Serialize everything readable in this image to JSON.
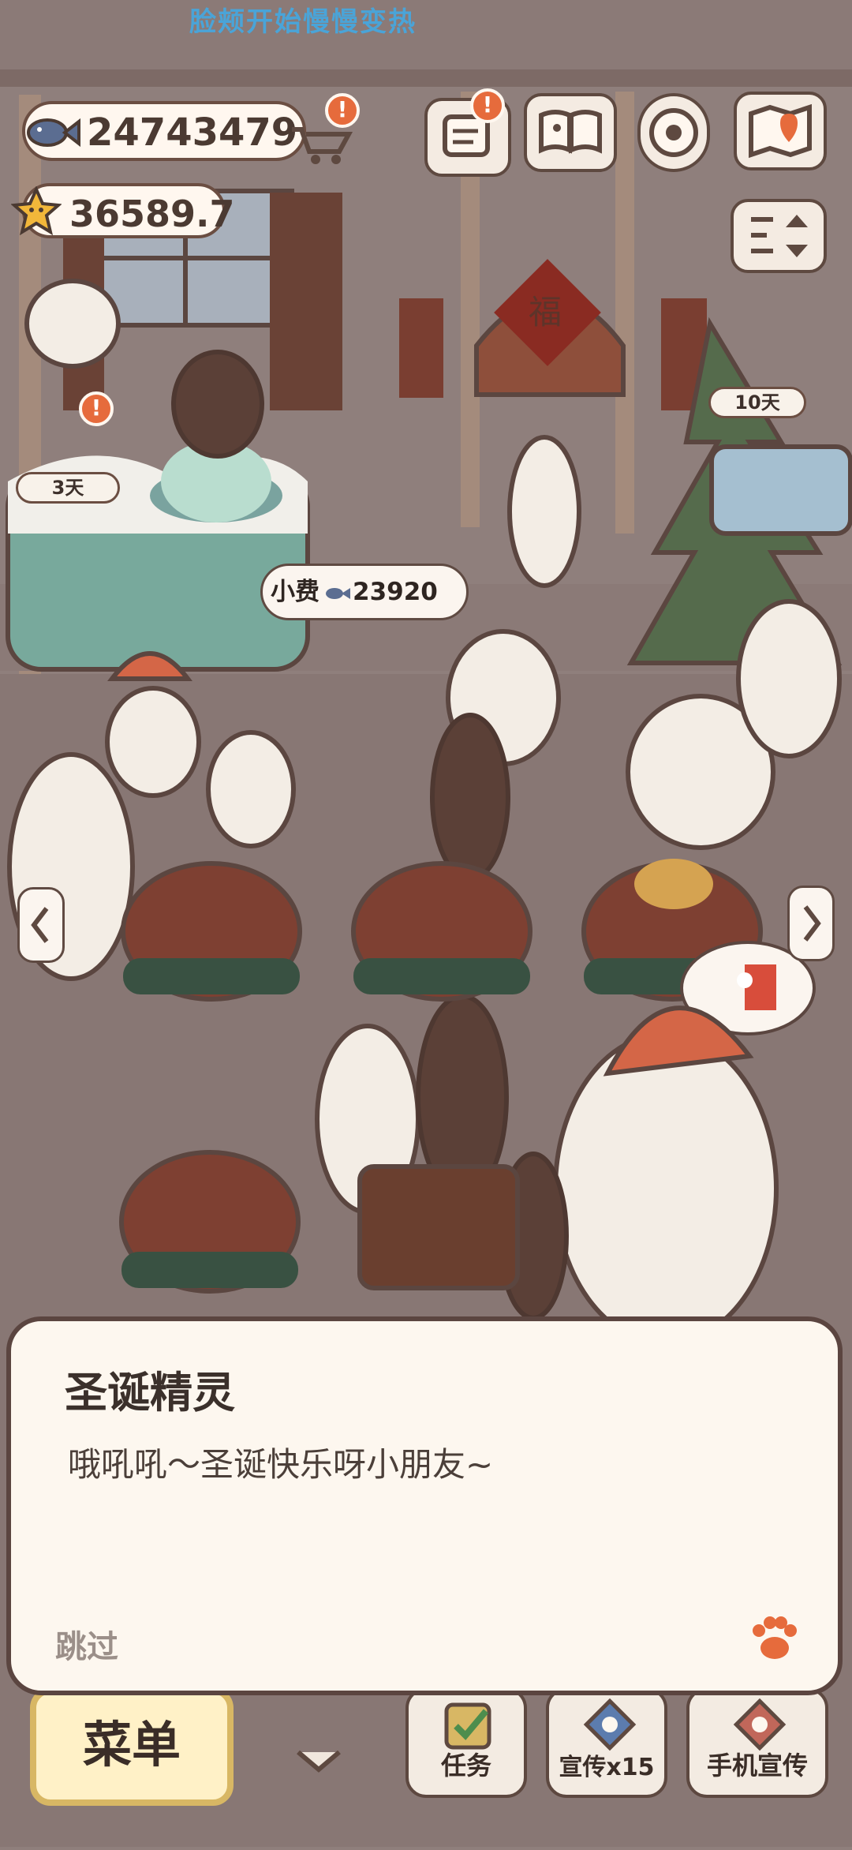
{
  "header": {
    "caption": "脸颊开始慢慢变热",
    "fish_currency": "24743479",
    "star_currency": "36589.7"
  },
  "badges": {
    "alert": "!"
  },
  "timers": {
    "left": "3天",
    "right": "10天"
  },
  "scene": {
    "tip_label": "小费",
    "tip_value": "23920"
  },
  "dialog": {
    "speaker": "圣诞精灵",
    "message": "哦吼吼～圣诞快乐呀小朋友~",
    "skip_label": "跳过"
  },
  "bottom_bar": {
    "menu_label": "菜单",
    "task_label": "任务",
    "promo_label": "宣传x15",
    "phone_promo_label": "手机宣传"
  },
  "colors": {
    "background": "#8f7f7c",
    "accent_orange": "#e66b3c",
    "dialog_bg": "#fdf7ef",
    "menu_gold": "#d8b764"
  },
  "icons": {
    "fish": "fish-icon",
    "star": "star-icon",
    "cart": "cart-icon",
    "notice": "notice-icon",
    "book": "book-icon",
    "settings": "gear-icon",
    "map": "map-icon",
    "paw": "paw-icon"
  }
}
